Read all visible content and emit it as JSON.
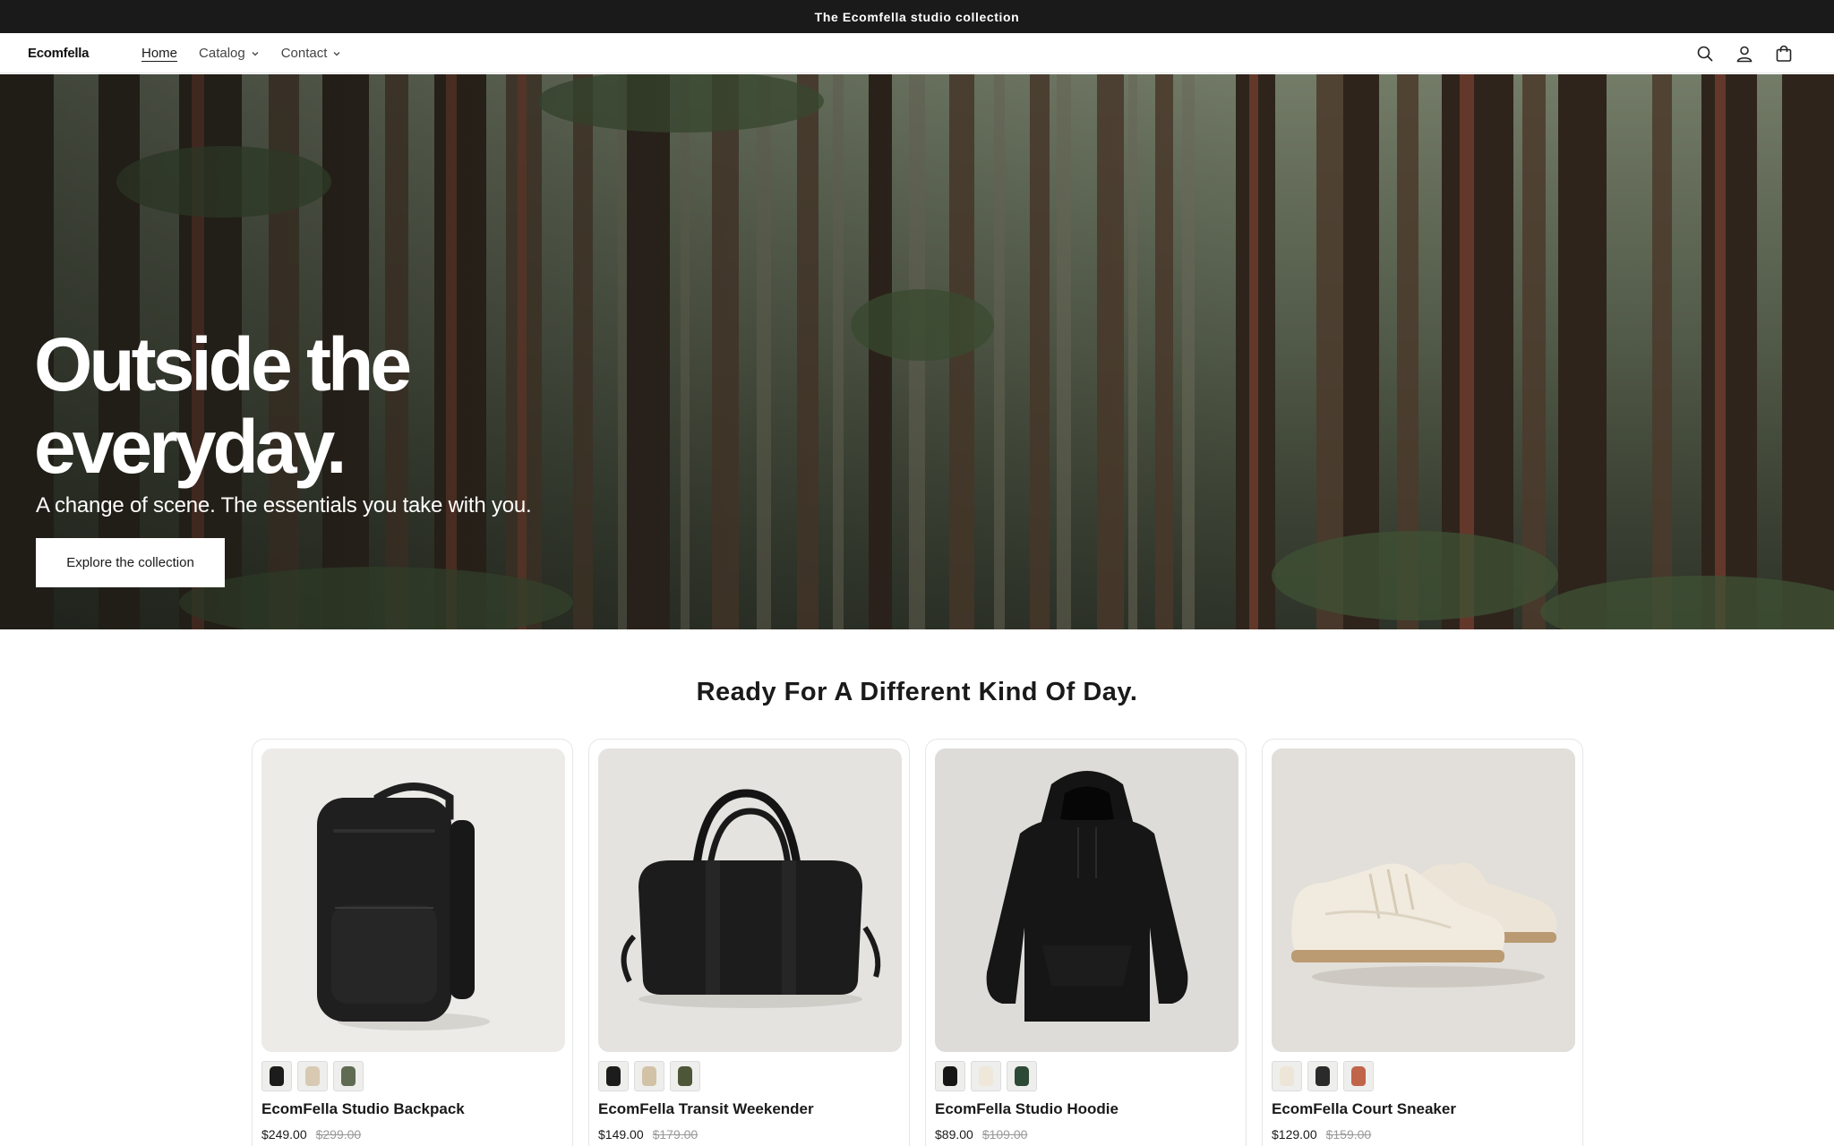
{
  "announcement": {
    "text": "The Ecomfella studio collection"
  },
  "header": {
    "logo": "Ecomfella",
    "nav": [
      {
        "label": "Home",
        "active": true,
        "has_dropdown": false
      },
      {
        "label": "Catalog",
        "active": false,
        "has_dropdown": true
      },
      {
        "label": "Contact",
        "active": false,
        "has_dropdown": true
      }
    ],
    "icons": [
      "search-icon",
      "account-icon",
      "cart-icon"
    ]
  },
  "hero": {
    "title": "Outside the everyday.",
    "subtitle": "A change of scene. The essentials you take with you.",
    "button_label": "Explore the collection"
  },
  "products_section": {
    "title": "Ready For A Different Kind Of Day.",
    "products": [
      {
        "name": "EcomFella Studio Backpack",
        "price": "$249.00",
        "compare_price": "$299.00",
        "image": "backpack",
        "swatches": [
          "#1c1c1c",
          "#d8c9b2",
          "#5f6b52"
        ]
      },
      {
        "name": "EcomFella Transit Weekender",
        "price": "$149.00",
        "compare_price": "$179.00",
        "image": "duffel",
        "swatches": [
          "#1c1c1c",
          "#d2c2a6",
          "#4d5638"
        ]
      },
      {
        "name": "EcomFella Studio Hoodie",
        "price": "$89.00",
        "compare_price": "$109.00",
        "image": "hoodie",
        "swatches": [
          "#161616",
          "#eee7da",
          "#2c4a35"
        ]
      },
      {
        "name": "EcomFella Court Sneaker",
        "price": "$129.00",
        "compare_price": "$159.00",
        "image": "sneaker",
        "swatches": [
          "#ede6d8",
          "#2a2a2a",
          "#c0644a"
        ]
      }
    ]
  },
  "colors": {
    "announcement_bg": "#1a1a1a",
    "text": "#1a1a1a",
    "card_border": "#e6e6e6",
    "image_bg": "#ededeb"
  }
}
